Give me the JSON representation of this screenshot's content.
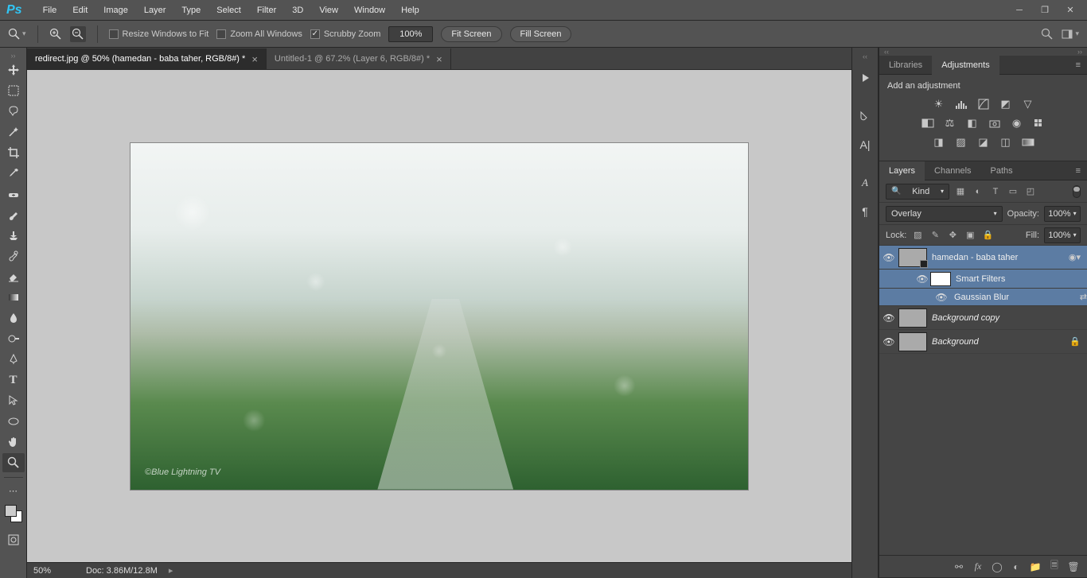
{
  "menubar": {
    "logo": "Ps",
    "items": [
      "File",
      "Edit",
      "Image",
      "Layer",
      "Type",
      "Select",
      "Filter",
      "3D",
      "View",
      "Window",
      "Help"
    ]
  },
  "options": {
    "resize_label": "Resize Windows to Fit",
    "zoom_all_label": "Zoom All Windows",
    "scrubby_label": "Scrubby Zoom",
    "zoom_value": "100%",
    "fit_screen": "Fit Screen",
    "fill_screen": "Fill Screen"
  },
  "tabs": [
    {
      "title": "redirect.jpg @ 50% (hamedan - baba taher, RGB/8#) *",
      "active": true
    },
    {
      "title": "Untitled-1 @ 67.2% (Layer 6, RGB/8#) *",
      "active": false
    }
  ],
  "canvas": {
    "watermark": "©Blue Lightning TV"
  },
  "status": {
    "zoom": "50%",
    "doc": "Doc: 3.86M/12.8M"
  },
  "adjustments": {
    "tab_libraries": "Libraries",
    "tab_adjustments": "Adjustments",
    "heading": "Add an adjustment"
  },
  "layers_panel": {
    "tab_layers": "Layers",
    "tab_channels": "Channels",
    "tab_paths": "Paths",
    "kind": "Kind",
    "blend_mode": "Overlay",
    "opacity_label": "Opacity:",
    "opacity_value": "100%",
    "lock_label": "Lock:",
    "fill_label": "Fill:",
    "fill_value": "100%",
    "layers": [
      {
        "name": "hamedan - baba taher",
        "selected": true,
        "smart": true,
        "group_badge": true
      },
      {
        "name": "Background copy",
        "italic": true
      },
      {
        "name": "Background",
        "italic": true,
        "locked": true
      }
    ],
    "smart_filters_label": "Smart Filters",
    "gaussian_blur": "Gaussian Blur"
  }
}
